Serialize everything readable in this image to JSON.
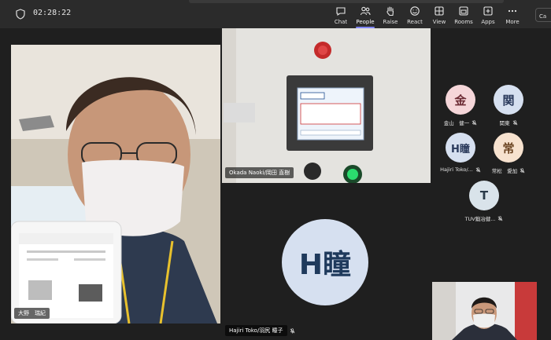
{
  "toolbar": {
    "timer": "02:28:22",
    "items": [
      {
        "label": "Chat",
        "icon": "chat-icon"
      },
      {
        "label": "People",
        "icon": "people-icon"
      },
      {
        "label": "Raise",
        "icon": "raise-hand-icon"
      },
      {
        "label": "React",
        "icon": "react-icon"
      },
      {
        "label": "View",
        "icon": "view-icon"
      },
      {
        "label": "Rooms",
        "icon": "rooms-icon"
      },
      {
        "label": "Apps",
        "icon": "apps-icon"
      },
      {
        "label": "More",
        "icon": "more-icon"
      }
    ],
    "leave_label": "Ca"
  },
  "participants": {
    "video_left": {
      "name": "大野　瑞紀"
    },
    "video_center": {
      "name": "Okada Naoki/岡田 直樹"
    },
    "big_avatar": {
      "initials": "H瞳",
      "name": "Hajiri Toko/羽尻 瞳子"
    },
    "small": [
      {
        "initials": "金",
        "name": "金山　健一",
        "bg": "#f5d6d9",
        "fg": "#6b2a33"
      },
      {
        "initials": "関",
        "name": "関東",
        "bg": "#d6e0f0",
        "fg": "#2a3a5c"
      },
      {
        "initials": "H瞳",
        "name": "Hajiri Toko/...",
        "bg": "#d6e0f0",
        "fg": "#2a3a5c"
      },
      {
        "initials": "常",
        "name": "常松　愛加",
        "bg": "#f7e2cf",
        "fg": "#6b4422"
      },
      {
        "initials": "T",
        "name": "TUV鍛冶健...",
        "bg": "#d9e3ea",
        "fg": "#2a3a48"
      }
    ]
  },
  "colors": {
    "accent": "#7f85f5",
    "avatar_bg": "#d6e0f0",
    "avatar_fg": "#1f3a5c"
  }
}
